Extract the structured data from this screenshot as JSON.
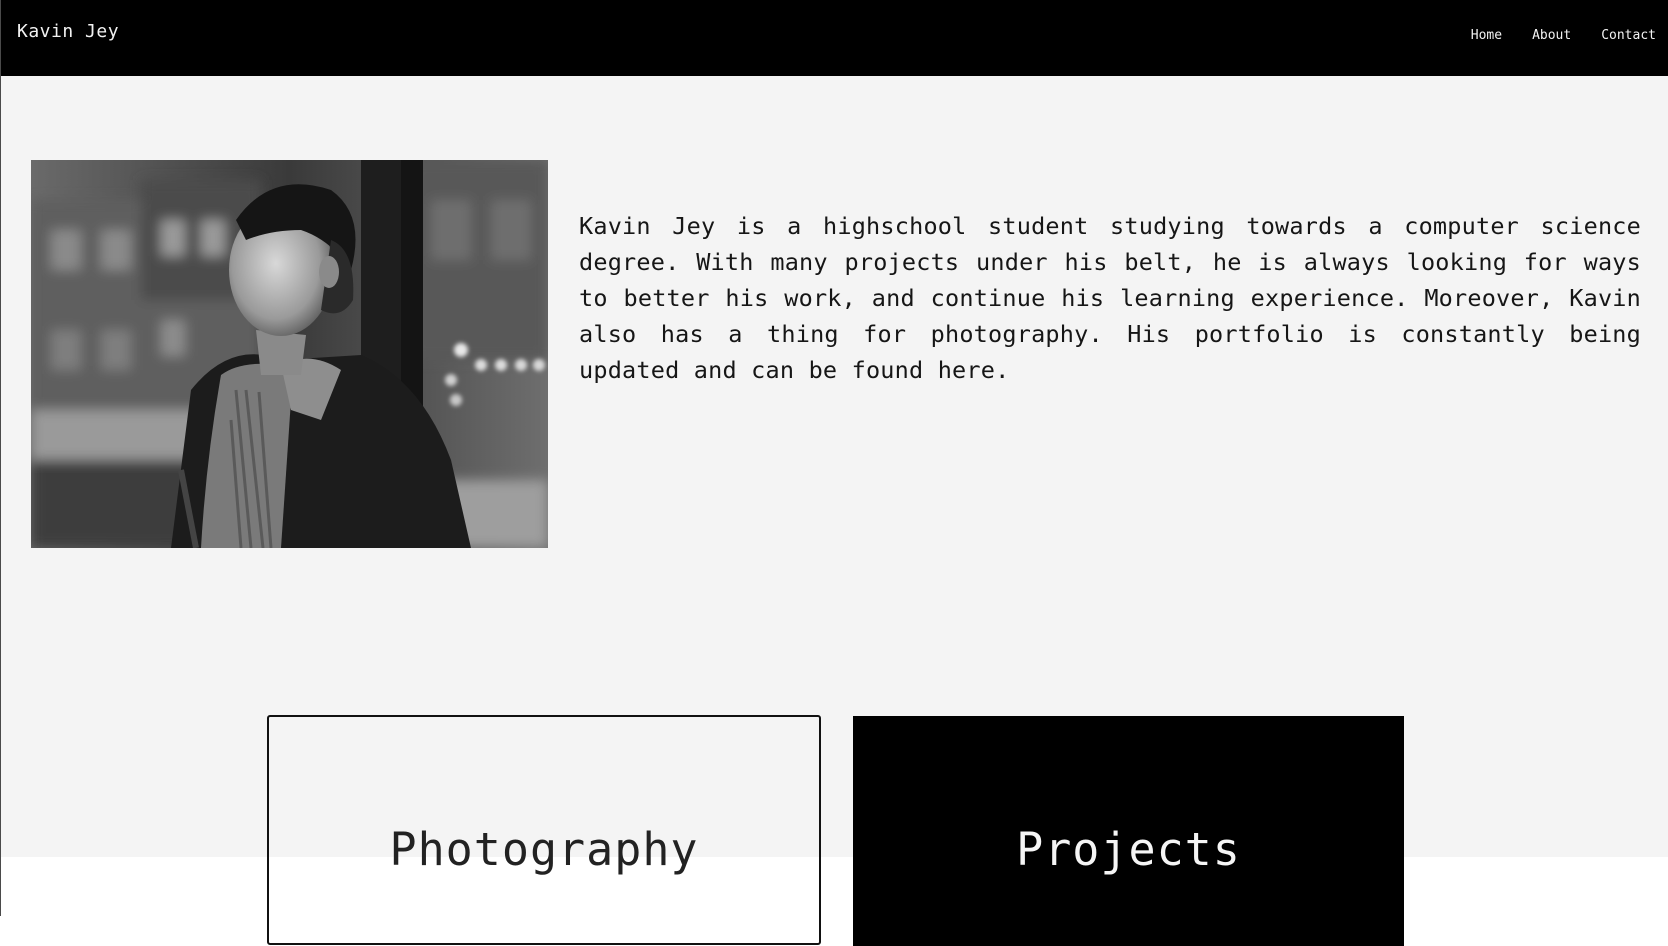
{
  "navbar": {
    "brand": "Kavin Jey",
    "links": [
      {
        "label": "Home"
      },
      {
        "label": "About"
      },
      {
        "label": "Contact"
      }
    ]
  },
  "about": {
    "bio": "Kavin Jey is a highschool student studying towards a computer science degree. With many projects under his belt, he is always looking for ways to better his work, and continue his learning experience. Moreover, Kavin also has a thing for photography. His portfolio is constantly being updated and can be found here."
  },
  "cards": {
    "photography": "Photography",
    "projects": "Projects"
  },
  "colors": {
    "navbar_bg": "#000000",
    "page_bg": "#f4f4f4",
    "text": "#161616",
    "projects_card_bg": "#000000"
  }
}
